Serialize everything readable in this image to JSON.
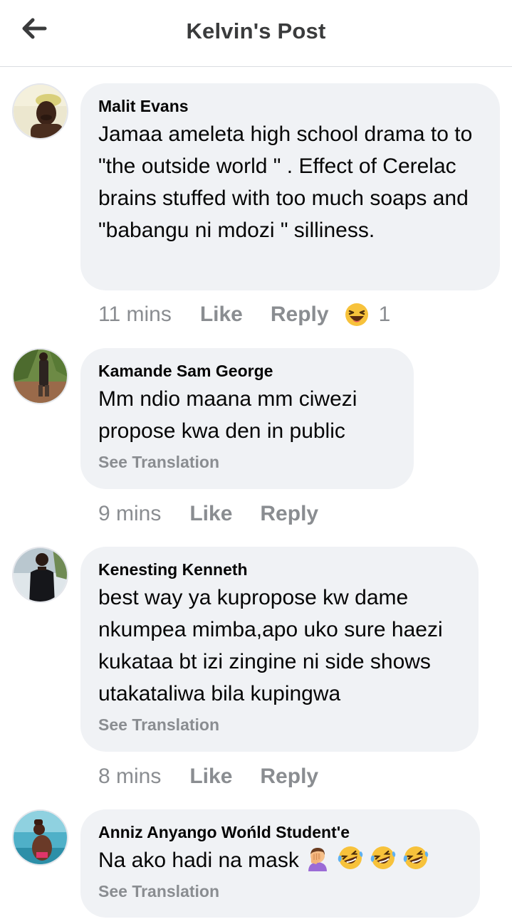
{
  "header": {
    "title": "Kelvin's Post",
    "back_icon": "arrow-left-icon"
  },
  "comments": [
    {
      "author": "Malit Evans",
      "text": "Jamaa ameleta high school drama to to \"the outside world \" . Effect of Cerelac brains stuffed with too much soaps and \"babangu ni mdozi \" silliness.",
      "time": "11 mins",
      "like_label": "Like",
      "reply_label": "Reply",
      "reaction_icon": "laughing-emoji-icon",
      "reaction_count": "1"
    },
    {
      "author": "Kamande Sam George",
      "text": "Mm ndio maana mm ciwezi propose kwa den in public",
      "see_translation": "See Translation",
      "time": "9 mins",
      "like_label": "Like",
      "reply_label": "Reply"
    },
    {
      "author": "Kenesting Kenneth",
      "text": "best way ya kupropose kw dame nkumpea mimba,apo uko sure haezi kukataa bt izi zingine ni side shows utakataliwa bila kupingwa",
      "see_translation": "See Translation",
      "time": "8 mins",
      "like_label": "Like",
      "reply_label": "Reply"
    },
    {
      "author": "Anniz Anyango Wońld Student'e",
      "text": "Na ako hadi na  mask",
      "text_emojis": [
        "facepalm-emoji-icon",
        "rolling-laughing-emoji-icon",
        "rolling-laughing-emoji-icon",
        "rolling-laughing-emoji-icon"
      ],
      "see_translation": "See Translation"
    }
  ]
}
